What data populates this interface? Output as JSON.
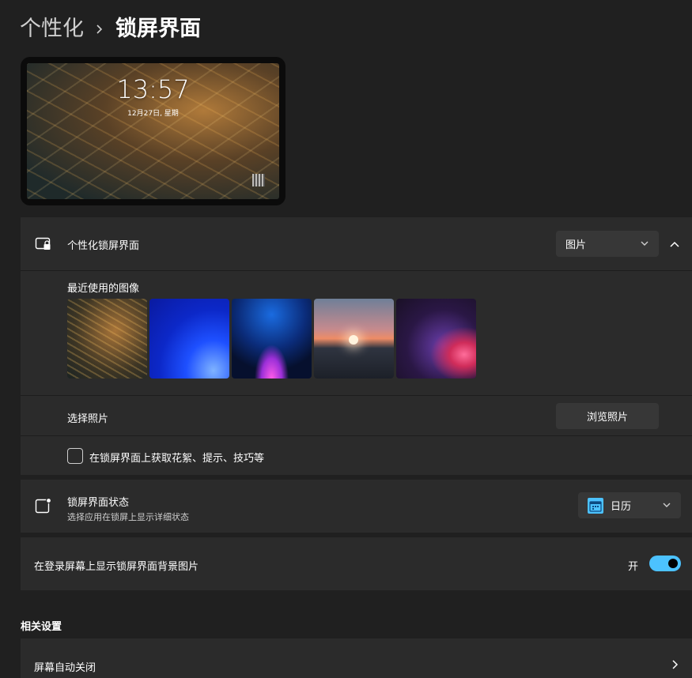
{
  "breadcrumb": {
    "parent": "个性化",
    "current": "锁屏界面"
  },
  "preview": {
    "time": "13:57",
    "date": "12月27日, 星期"
  },
  "personalize": {
    "label": "个性化锁屏界面",
    "dropdown_value": "图片",
    "recent_title": "最近使用的图像",
    "choose_photo_label": "选择照片",
    "browse_button": "浏览照片",
    "tips_label": "在锁屏界面上获取花絮、提示、技巧等",
    "tips_checked": false
  },
  "status": {
    "label": "锁屏界面状态",
    "description": "选择应用在锁屏上显示详细状态",
    "dropdown_value": "日历"
  },
  "signin": {
    "label": "在登录屏幕上显示锁屏界面背景图片",
    "toggle_state": "开",
    "toggle_on": true
  },
  "related": {
    "title": "相关设置",
    "items": [
      {
        "label": "屏幕自动关闭"
      }
    ]
  },
  "colors": {
    "accent": "#4cc2ff",
    "background": "#202020",
    "card": "#2b2b2b",
    "control": "#373737"
  }
}
